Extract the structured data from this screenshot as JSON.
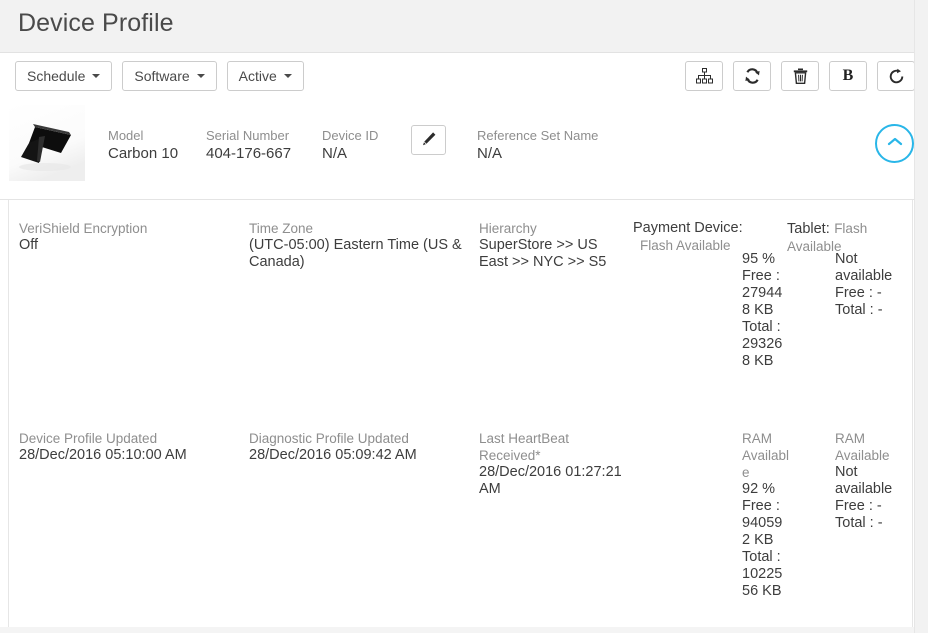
{
  "page": {
    "title": "Device Profile"
  },
  "toolbar": {
    "dropdowns": [
      {
        "label": "Schedule",
        "name": "schedule-dropdown"
      },
      {
        "label": "Software",
        "name": "software-dropdown"
      },
      {
        "label": "Active",
        "name": "active-dropdown"
      }
    ],
    "actions": [
      {
        "icon": "hierarchy-icon",
        "title": "Hierarchy"
      },
      {
        "icon": "sync-icon",
        "title": "Sync"
      },
      {
        "icon": "trash-icon",
        "title": "Delete"
      },
      {
        "icon": "bold-b-icon",
        "title": "B",
        "glyph": "B"
      },
      {
        "icon": "refresh-icon",
        "title": "Refresh"
      }
    ]
  },
  "summary": {
    "device_image_alt": "payment-terminal",
    "fields": [
      {
        "label": "Model",
        "value": "Carbon 10"
      },
      {
        "label": "Serial Number",
        "value": "404-176-667"
      },
      {
        "label": "Device ID",
        "value": "N/A"
      },
      {
        "label": "Reference Set Name",
        "value": "N/A"
      }
    ],
    "edit_icon": "pencil-icon",
    "collapse_icon": "chevron-up-icon"
  },
  "details": {
    "verishield": {
      "label": "VeriShield Encryption",
      "value": "Off"
    },
    "timezone": {
      "label": "Time Zone",
      "value": "(UTC-05:00) Eastern Time (US & Canada)"
    },
    "hierarchy": {
      "label": "Hierarchy",
      "value": "SuperStore >> US East >> NYC >> S5"
    },
    "payment_device": {
      "label": "Payment Device:",
      "sub": "Flash Available"
    },
    "tablet": {
      "label": "Tablet:",
      "sub": "Flash Available"
    },
    "flash_primary": {
      "value": "95 % Free : 279448 KB Total : 293268 KB"
    },
    "flash_secondary": {
      "value": "Not available Free : - Total : -"
    },
    "device_profile_updated": {
      "label": "Device Profile Updated",
      "value": "28/Dec/2016 05:10:00 AM"
    },
    "diagnostic_profile_updated": {
      "label": "Diagnostic Profile Updated",
      "value": "28/Dec/2016 05:09:42 AM"
    },
    "last_heartbeat": {
      "label": "Last HeartBeat Received*",
      "value": "28/Dec/2016 01:27:21 AM"
    },
    "ram_primary": {
      "label": "RAM Available",
      "value": "92 % Free : 940592 KB Total : 1022556 KB"
    },
    "ram_secondary": {
      "label": "RAM Available",
      "value": "Not available Free : - Total : -"
    }
  },
  "colors": {
    "accent": "#29b6e8",
    "header_bg": "#f2f2f2",
    "label_text": "#8e8e8e",
    "value_text": "#3d3d3d",
    "border": "#cccccc"
  }
}
